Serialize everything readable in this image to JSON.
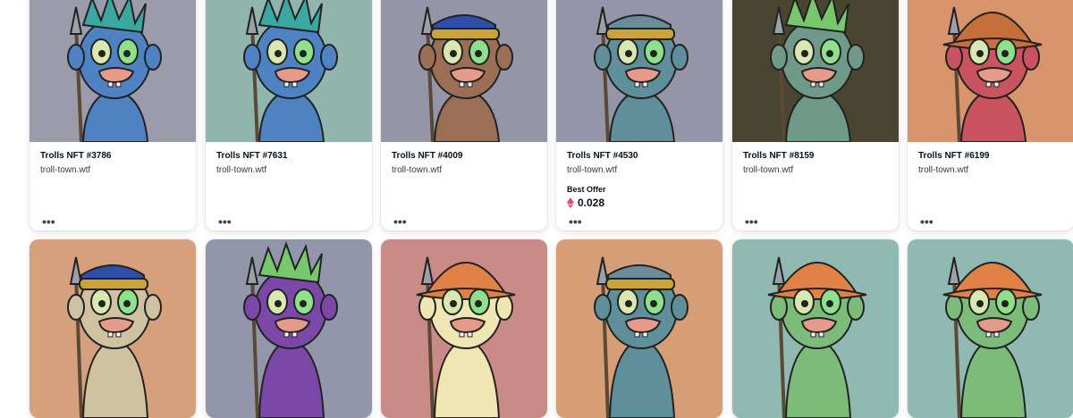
{
  "more_label": "•••",
  "row1": [
    {
      "title": "Trolls NFT #3786",
      "collection": "troll-town.wtf",
      "bg": "#9a9bab",
      "skin": "#4f82c3",
      "hat": "none",
      "hair": "#3aa8a0"
    },
    {
      "title": "Trolls NFT #7631",
      "collection": "troll-town.wtf",
      "bg": "#8fb5ad",
      "skin": "#4f82c3",
      "hat": "none",
      "hair": "#3aa8a0"
    },
    {
      "title": "Trolls NFT #4009",
      "collection": "troll-town.wtf",
      "bg": "#9496a8",
      "skin": "#9b6f55",
      "hat": "band",
      "hair": "#2d4fa6"
    },
    {
      "title": "Trolls NFT #4530",
      "collection": "troll-town.wtf",
      "bg": "#9495a8",
      "skin": "#5f8f9a",
      "hat": "band",
      "hair": "#6b8c9a",
      "best_offer_label": "Best Offer",
      "price": "0.028"
    },
    {
      "title": "Trolls NFT #8159",
      "collection": "troll-town.wtf",
      "bg": "#4a4530",
      "skin": "#6f9a8a",
      "hat": "none",
      "hair": "#77c86a"
    },
    {
      "title": "Trolls NFT #6199",
      "collection": "troll-town.wtf",
      "bg": "#d8946a",
      "skin": "#c9535f",
      "hat": "cone",
      "hair": "#c76f3a"
    }
  ],
  "row2": [
    {
      "bg": "#d6a07c",
      "skin": "#cfc2a0",
      "hat": "band",
      "hair": "#2d4fa6"
    },
    {
      "bg": "#9296ab",
      "skin": "#7b48a8",
      "hat": "none",
      "hair": "#77c86a"
    },
    {
      "bg": "#c98b86",
      "skin": "#efe6b4",
      "hat": "cone",
      "hair": "#e08246"
    },
    {
      "bg": "#d69e76",
      "skin": "#5f8f9a",
      "hat": "band",
      "hair": "#6b8c9a"
    },
    {
      "bg": "#8fb9b1",
      "skin": "#7dbb7a",
      "hat": "cone",
      "hair": "#e08246"
    },
    {
      "bg": "#8fb9b1",
      "skin": "#7dbb7a",
      "hat": "cone",
      "hair": "#e08246"
    }
  ],
  "colors": {
    "eth": "#e0447a"
  }
}
